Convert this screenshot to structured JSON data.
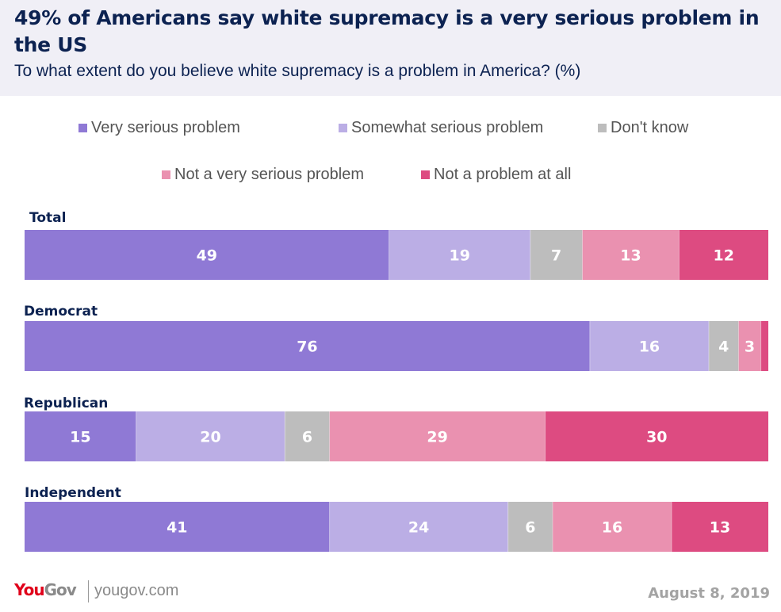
{
  "header": {
    "title": "49% of Americans say white supremacy is a very serious problem in the US",
    "subtitle": "To what extent do you believe white supremacy is a problem in America? (%)"
  },
  "footer": {
    "logo_you": "You",
    "logo_gov": "Gov",
    "site": "yougov.com",
    "date": "August 8, 2019"
  },
  "chart_data": {
    "type": "bar",
    "orientation": "horizontal",
    "stacked": true,
    "title": "49% of Americans say white supremacy is a very serious problem in the US",
    "subtitle": "To what extent do you believe white supremacy is a problem in America? (%)",
    "xlabel": "",
    "ylabel": "",
    "xlim": [
      0,
      100
    ],
    "grid": false,
    "legend_position": "top",
    "categories": [
      "Total",
      "Democrat",
      "Republican",
      "Independent"
    ],
    "series": [
      {
        "name": "Very serious problem",
        "color": "#8f79d5",
        "values": [
          49,
          76,
          15,
          41
        ],
        "labels": [
          "49",
          "76",
          "15",
          "41"
        ]
      },
      {
        "name": "Somewhat serious problem",
        "color": "#bbaee5",
        "values": [
          19,
          16,
          20,
          24
        ],
        "labels": [
          "19",
          "16",
          "20",
          "24"
        ]
      },
      {
        "name": "Don't know",
        "color": "#bdbdbd",
        "values": [
          7,
          4,
          6,
          6
        ],
        "labels": [
          "7",
          "4",
          "6",
          "6"
        ]
      },
      {
        "name": "Not a very serious problem",
        "color": "#ea91b0",
        "values": [
          13,
          3,
          29,
          16
        ],
        "labels": [
          "13",
          "3",
          "29",
          "16"
        ]
      },
      {
        "name": "Not a problem at all",
        "color": "#dd4b81",
        "values": [
          12,
          1,
          30,
          13
        ],
        "labels": [
          "12",
          "",
          "30",
          "13"
        ]
      }
    ]
  }
}
